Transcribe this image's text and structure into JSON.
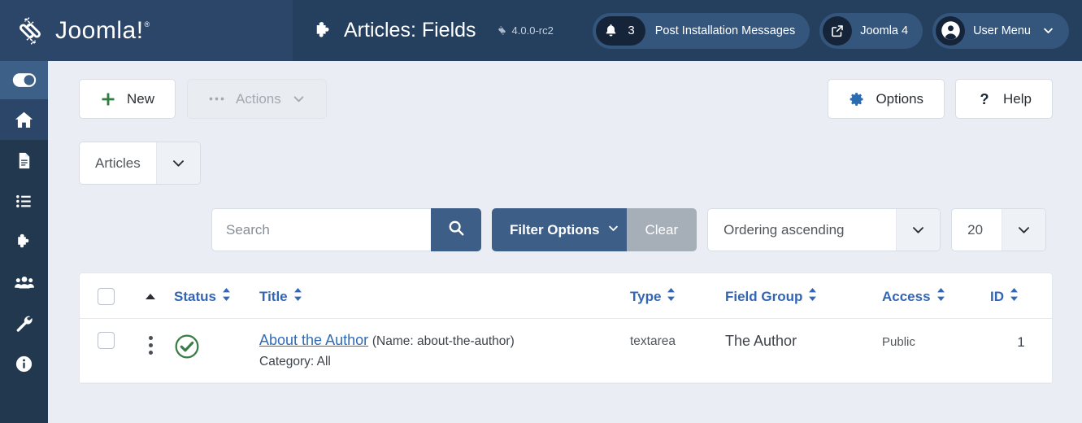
{
  "header": {
    "brand_name": "Joomla!",
    "brand_trademark": "®",
    "brand_logo_icon": "joomla-logo-icon",
    "page_icon": "puzzle-piece-icon",
    "page_title": "Articles: Fields",
    "version_icon": "joomla-mark-icon",
    "version": "4.0.0-rc2",
    "messages": {
      "icon": "bell-icon",
      "count": "3",
      "label": "Post Installation Messages"
    },
    "site_link": {
      "icon": "external-link-icon",
      "label": "Joomla 4"
    },
    "user_menu": {
      "icon": "user-circle-icon",
      "label": "User Menu",
      "chevron": "chevron-down-icon"
    }
  },
  "sidebar": {
    "items": [
      {
        "name": "toggle-menu",
        "icon": "toggle-switch-icon",
        "active": true
      },
      {
        "name": "home",
        "icon": "home-icon",
        "active": false
      },
      {
        "name": "content",
        "icon": "document-icon",
        "active": false
      },
      {
        "name": "menus",
        "icon": "list-icon",
        "active": false
      },
      {
        "name": "components",
        "icon": "puzzle-piece-icon",
        "active": false
      },
      {
        "name": "users",
        "icon": "users-icon",
        "active": false
      },
      {
        "name": "system",
        "icon": "wrench-icon",
        "active": false
      },
      {
        "name": "help",
        "icon": "info-circle-icon",
        "active": false
      }
    ]
  },
  "toolbar": {
    "new_label": "New",
    "new_icon": "plus-icon",
    "actions_label": "Actions",
    "actions_icon": "ellipsis-icon",
    "actions_chevron": "chevron-down-icon",
    "options_label": "Options",
    "options_icon": "gear-icon",
    "help_label": "Help",
    "help_icon": "question-mark-icon"
  },
  "filters": {
    "context_select": "Articles",
    "search_placeholder": "Search",
    "search_value": "",
    "search_icon": "magnifier-icon",
    "filter_options_label": "Filter Options",
    "filter_options_chevron": "chevron-down-icon",
    "clear_label": "Clear",
    "ordering_select": "Ordering ascending",
    "limit_select": "20"
  },
  "table": {
    "columns": [
      {
        "key": "check",
        "label": "",
        "sortable": false
      },
      {
        "key": "ord",
        "label": "",
        "sortable": false,
        "icon": "caret-up-icon"
      },
      {
        "key": "status",
        "label": "Status",
        "sortable": true
      },
      {
        "key": "title",
        "label": "Title",
        "sortable": true
      },
      {
        "key": "type",
        "label": "Type",
        "sortable": true
      },
      {
        "key": "group",
        "label": "Field Group",
        "sortable": true
      },
      {
        "key": "access",
        "label": "Access",
        "sortable": true
      },
      {
        "key": "id",
        "label": "ID",
        "sortable": true
      }
    ],
    "rows": [
      {
        "status_icon": "check-circle-icon",
        "status_label": "Published",
        "title": "About the Author",
        "title_note": "(Name: about-the-author)",
        "title_sub": "Category: All",
        "type": "textarea",
        "group": "The Author",
        "access": "Public",
        "id": "1"
      }
    ]
  },
  "colors": {
    "header_bg": "#25405f",
    "brand_bg": "#2b4669",
    "sidebar_bg": "#22384f",
    "sidebar_active": "#3d6089",
    "content_bg": "#eaeef4",
    "accent_blue": "#3c5e87",
    "link_blue": "#2e6bb8",
    "header_blue": "#3266b5",
    "success_green": "#3a7d44",
    "muted_grey": "#a6aeb8"
  }
}
